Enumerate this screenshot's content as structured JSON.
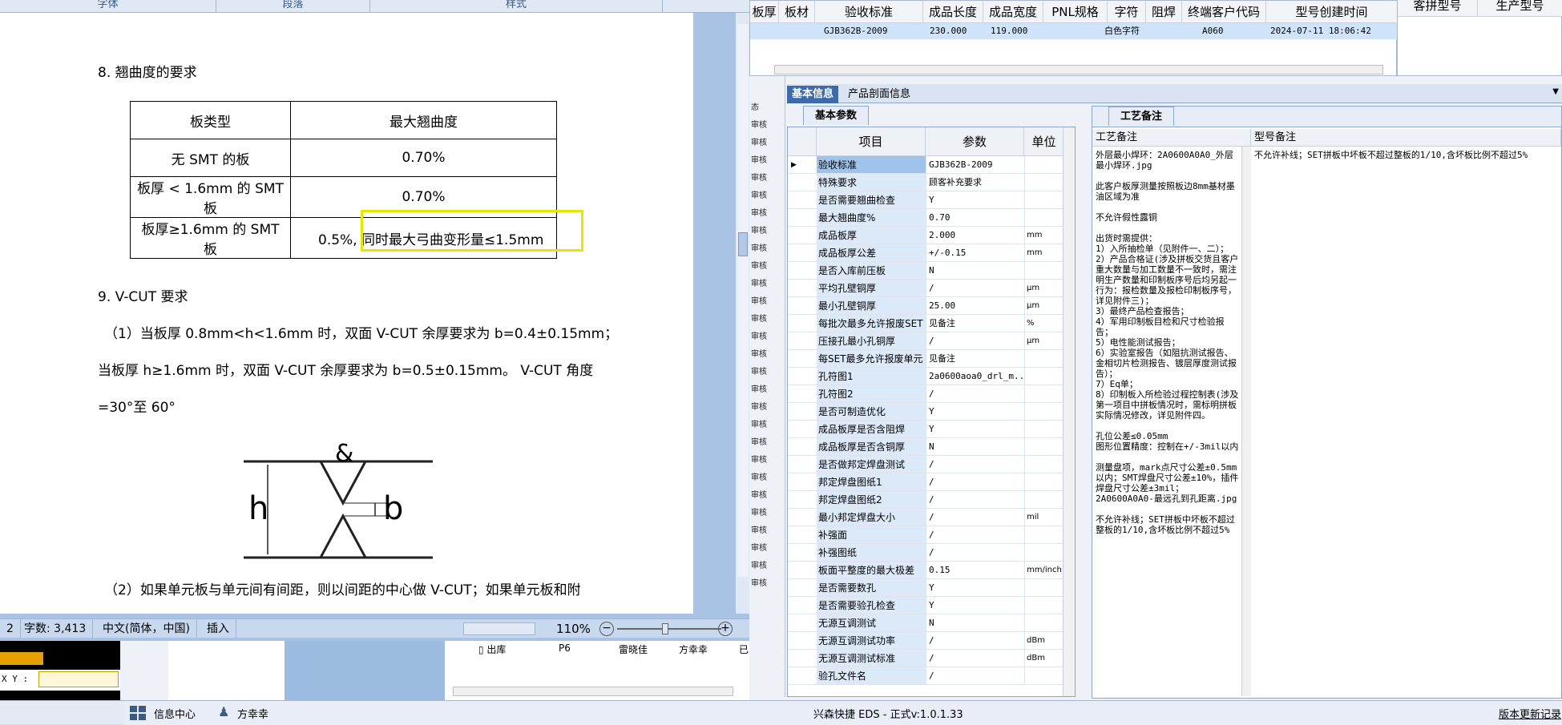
{
  "word": {
    "ribbon": [
      "字体",
      "段落",
      "样式"
    ],
    "heading8": "8. 翘曲度的要求",
    "table": {
      "headers": [
        "板类型",
        "最大翘曲度"
      ],
      "rows": [
        [
          "无 SMT 的板",
          "0.70%"
        ],
        [
          "板厚 < 1.6mm 的 SMT 板",
          "0.70%"
        ],
        [
          "板厚≥1.6mm 的 SMT 板",
          "0.5%, 同时最大弓曲变形量≤1.5mm"
        ]
      ]
    },
    "heading9": "9. V-CUT 要求",
    "p1": "（1）当板厚 0.8mm<h<1.6mm 时，双面 V-CUT 余厚要求为 b=0.4±0.15mm；",
    "p2": "当板厚 h≥1.6mm 时，双面 V-CUT 余厚要求为 b=0.5±0.15mm。 V-CUT 角度",
    "p3": "=30°至 60°",
    "diagram": {
      "h": "h",
      "b": "b"
    },
    "p4": "（2）如果单元板与单元间有间距，则以间距的中心做 V-CUT；如果单元板和附",
    "status": {
      "page": "2",
      "words": "字数: 3,413",
      "lang": "中文(简体，中国)",
      "mode": "插入",
      "zoom": "110%"
    }
  },
  "erp": {
    "grid_headers": [
      "板厚",
      "板材",
      "验收标准",
      "成品长度",
      "成品宽度",
      "PNL规格",
      "字符",
      "阻焊",
      "终端客户代码",
      "型号创建时间"
    ],
    "grid_row": {
      "std": "GJB362B-2009",
      "len": "230.000",
      "wid": "119.000",
      "char": "白色字符",
      "cust": "A060",
      "time": "2024-07-11 18:06:42"
    },
    "right_headers": [
      "客拼型号",
      "生产型号"
    ],
    "tabs": [
      "基本信息",
      "产品剖面信息"
    ],
    "subtab": "基本参数",
    "params_headers": [
      "项目",
      "参数",
      "单位"
    ],
    "params": [
      [
        "验收标准",
        "GJB362B-2009",
        ""
      ],
      [
        "特殊要求",
        "顾客补充要求",
        ""
      ],
      [
        "是否需要翘曲检查",
        "Y",
        ""
      ],
      [
        "最大翘曲度%",
        "0.70",
        ""
      ],
      [
        "成品板厚",
        "2.000",
        "mm"
      ],
      [
        "成品板厚公差",
        "+/-0.15",
        "mm"
      ],
      [
        "是否入库前压板",
        "N",
        ""
      ],
      [
        "平均孔壁铜厚",
        "/",
        "μm"
      ],
      [
        "最小孔壁铜厚",
        "25.00",
        "μm"
      ],
      [
        "每批次最多允许报废SET",
        "见备注",
        "%"
      ],
      [
        "压接孔最小孔铜厚",
        "/",
        "μm"
      ],
      [
        "每SET最多允许报废单元",
        "见备注",
        ""
      ],
      [
        "孔符图1",
        "2a0600aoa0_drl_m...",
        ""
      ],
      [
        "孔符图2",
        "/",
        ""
      ],
      [
        "是否可制造优化",
        "Y",
        ""
      ],
      [
        "成品板厚是否含阻焊",
        "Y",
        ""
      ],
      [
        "成品板厚是否含铜厚",
        "N",
        ""
      ],
      [
        "是否做邦定焊盘测试",
        "/",
        ""
      ],
      [
        "邦定焊盘图纸1",
        "/",
        ""
      ],
      [
        "邦定焊盘图纸2",
        "/",
        ""
      ],
      [
        "最小邦定焊盘大小",
        "/",
        "mil"
      ],
      [
        "补强面",
        "/",
        ""
      ],
      [
        "补强图纸",
        "/",
        ""
      ],
      [
        "板面平整度的最大极差",
        "0.15",
        "mm/inch"
      ],
      [
        "是否需要数孔",
        "Y",
        ""
      ],
      [
        "是否需要验孔检查",
        "Y",
        ""
      ],
      [
        "无源互调测试",
        "N",
        ""
      ],
      [
        "无源互调测试功率",
        "/",
        "dBm"
      ],
      [
        "无源互调测试标准",
        "/",
        "dBm"
      ],
      [
        "验孔文件名",
        "/",
        ""
      ]
    ],
    "notes_tab": "工艺备注",
    "notes_headers": [
      "工艺备注",
      "型号备注"
    ],
    "process_notes": "外层最小焊环：2A0600A0A0_外层最小焊环.jpg\n\n此客户板厚测量按照板边8mm基材墨油区域为准\n\n不允许假性露铜\n\n出货时需提供：\n1）入所抽检单（见附件一、二）；\n2）产品合格证(涉及拼板交货且客户重大数量与加工数量不一致时，需注明生产数量和印制板序号后均另起一行为：报检数量及报检印制板序号，详见附件三)；\n3）最终产品检查报告；\n4）军用印制板目检和尺寸检验报告；\n5）电性能测试报告；\n6）实验室报告（如阻抗测试报告、金相切片检测报告、镀层厚度测试报告）；\n7）Eq单；\n8）印制板入所检验过程控制表(涉及第一项目中拼板情况时，需标明拼板实际情况修改，详见附件四。\n\n孔位公差≤0.05mm\n图形位置精度：控制在+/-3mil以内\n\n测量盘项，mark点尺寸公差±0.5mm以内；SMT焊盘尺寸公差±10%，插件焊盘尺寸公差±3mil；\n2A0600A0A0-最远孔到孔距离.jpg\n\n不允许补线；SET拼板中坏板不超过整板的1/10,含坏板比例不超过5%",
    "model_notes": "不允许补线；SET拼板中坏板不超过整板的1/10,含坏板比例不超过5%",
    "left_strip": [
      "态",
      "审核",
      "审核",
      "审核",
      "审核",
      "审核",
      "审核",
      "审核",
      "审核",
      "审核",
      "审核",
      "审核",
      "审核",
      "审核",
      "审核",
      "审核",
      "审核",
      "审核",
      "审核",
      "审核",
      "审核",
      "审核",
      "审核",
      "审核",
      "审核",
      "审核",
      "审核",
      "审核"
    ]
  },
  "bottom": {
    "xy_label": "X Y :",
    "row": [
      "出库",
      "P6",
      "雷晓佳",
      "方幸幸",
      "已审核"
    ]
  },
  "statusbar": {
    "info_center": "信息中心",
    "user": "方幸幸",
    "app": "兴森快捷 EDS - 正式v:1.0.1.33",
    "update": "版本更新记录"
  }
}
